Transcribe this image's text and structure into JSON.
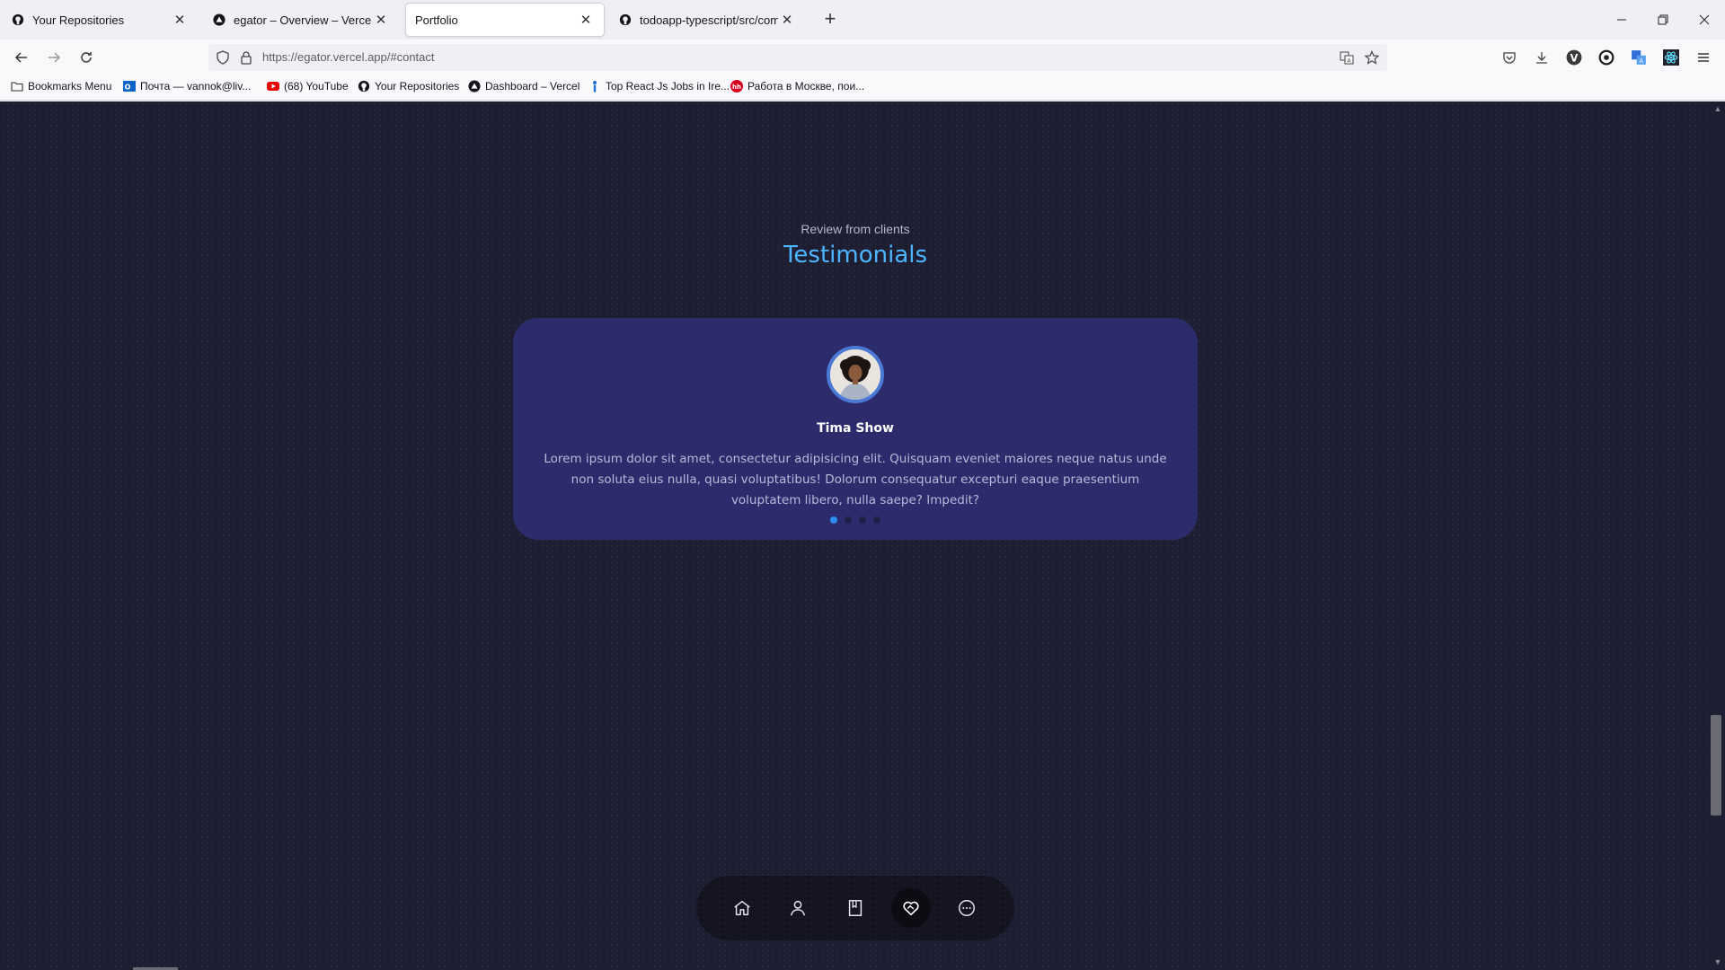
{
  "tabs": [
    {
      "title": "Your Repositories",
      "icon": "github-icon",
      "active": false
    },
    {
      "title": "egator – Overview – Vercel",
      "icon": "vercel-icon",
      "active": false
    },
    {
      "title": "Portfolio",
      "icon": "",
      "active": true
    },
    {
      "title": "todoapp-typescript/src/compo",
      "icon": "github-icon",
      "active": false
    }
  ],
  "address": {
    "url": "https://egator.vercel.app/#contact"
  },
  "bookmarks": [
    {
      "label": "Bookmarks Menu",
      "icon": "folder-icon"
    },
    {
      "label": "Почта — vannok@liv...",
      "icon": "outlook-icon"
    },
    {
      "label": "(68) YouTube",
      "icon": "youtube-icon"
    },
    {
      "label": "Your Repositories",
      "icon": "github-icon"
    },
    {
      "label": "Dashboard – Vercel",
      "icon": "vercel-icon"
    },
    {
      "label": "Top React Js Jobs in Ire...",
      "icon": "jobs-icon"
    },
    {
      "label": "Работа в Москве, пои...",
      "icon": "hh-icon"
    }
  ],
  "section": {
    "subtitle": "Review from clients",
    "heading": "Testimonials"
  },
  "testimonial": {
    "name": "Tima Show",
    "quote": "Lorem ipsum dolor sit amet, consectetur adipisicing elit. Quisquam eveniet maiores neque natus unde non soluta eius nulla, quasi voluptatibus! Dolorum consequatur excepturi eaque praesentium voluptatem libero, nulla saepe? Impedit?",
    "slide_count": 4,
    "active_slide": 1
  },
  "bottom_nav": [
    {
      "icon": "home-icon",
      "active": false
    },
    {
      "icon": "user-icon",
      "active": false
    },
    {
      "icon": "book-icon",
      "active": false
    },
    {
      "icon": "handshake-heart-icon",
      "active": true
    },
    {
      "icon": "chat-icon",
      "active": false
    }
  ],
  "colors": {
    "page_bg": "#1e1e32",
    "card_bg": "#2c2c6c",
    "accent": "#4db5ff",
    "dot_active": "#2d8cf0"
  }
}
